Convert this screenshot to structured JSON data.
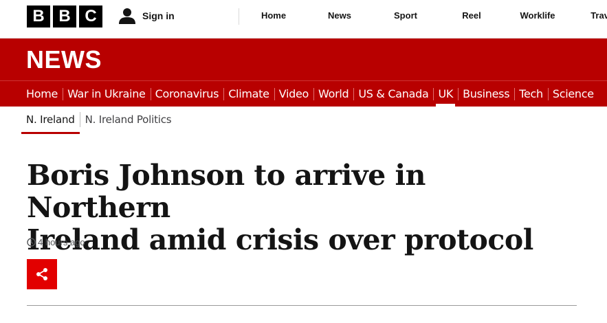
{
  "header": {
    "logo_letters": [
      "B",
      "B",
      "C"
    ],
    "signin_label": "Sign in",
    "nav": [
      "Home",
      "News",
      "Sport",
      "Reel",
      "Worklife",
      "Travel"
    ]
  },
  "banner": {
    "title": "NEWS"
  },
  "section_nav": {
    "items": [
      "Home",
      "War in Ukraine",
      "Coronavirus",
      "Climate",
      "Video",
      "World",
      "US & Canada",
      "UK",
      "Business",
      "Tech",
      "Science"
    ],
    "active": "UK"
  },
  "sub_nav": {
    "items": [
      "N. Ireland",
      "N. Ireland Politics"
    ],
    "current": "N. Ireland"
  },
  "article": {
    "headline_line1": "Boris Johnson to arrive in Northern",
    "headline_line2": "Ireland amid crisis over protocol",
    "timestamp": "4 hours ago"
  },
  "icons": {
    "signin": "user-icon",
    "timestamp": "clock-icon",
    "share": "share-icon"
  },
  "colors": {
    "brand_red": "#b80000",
    "share_red": "#e20000",
    "logo_black": "#000000"
  }
}
